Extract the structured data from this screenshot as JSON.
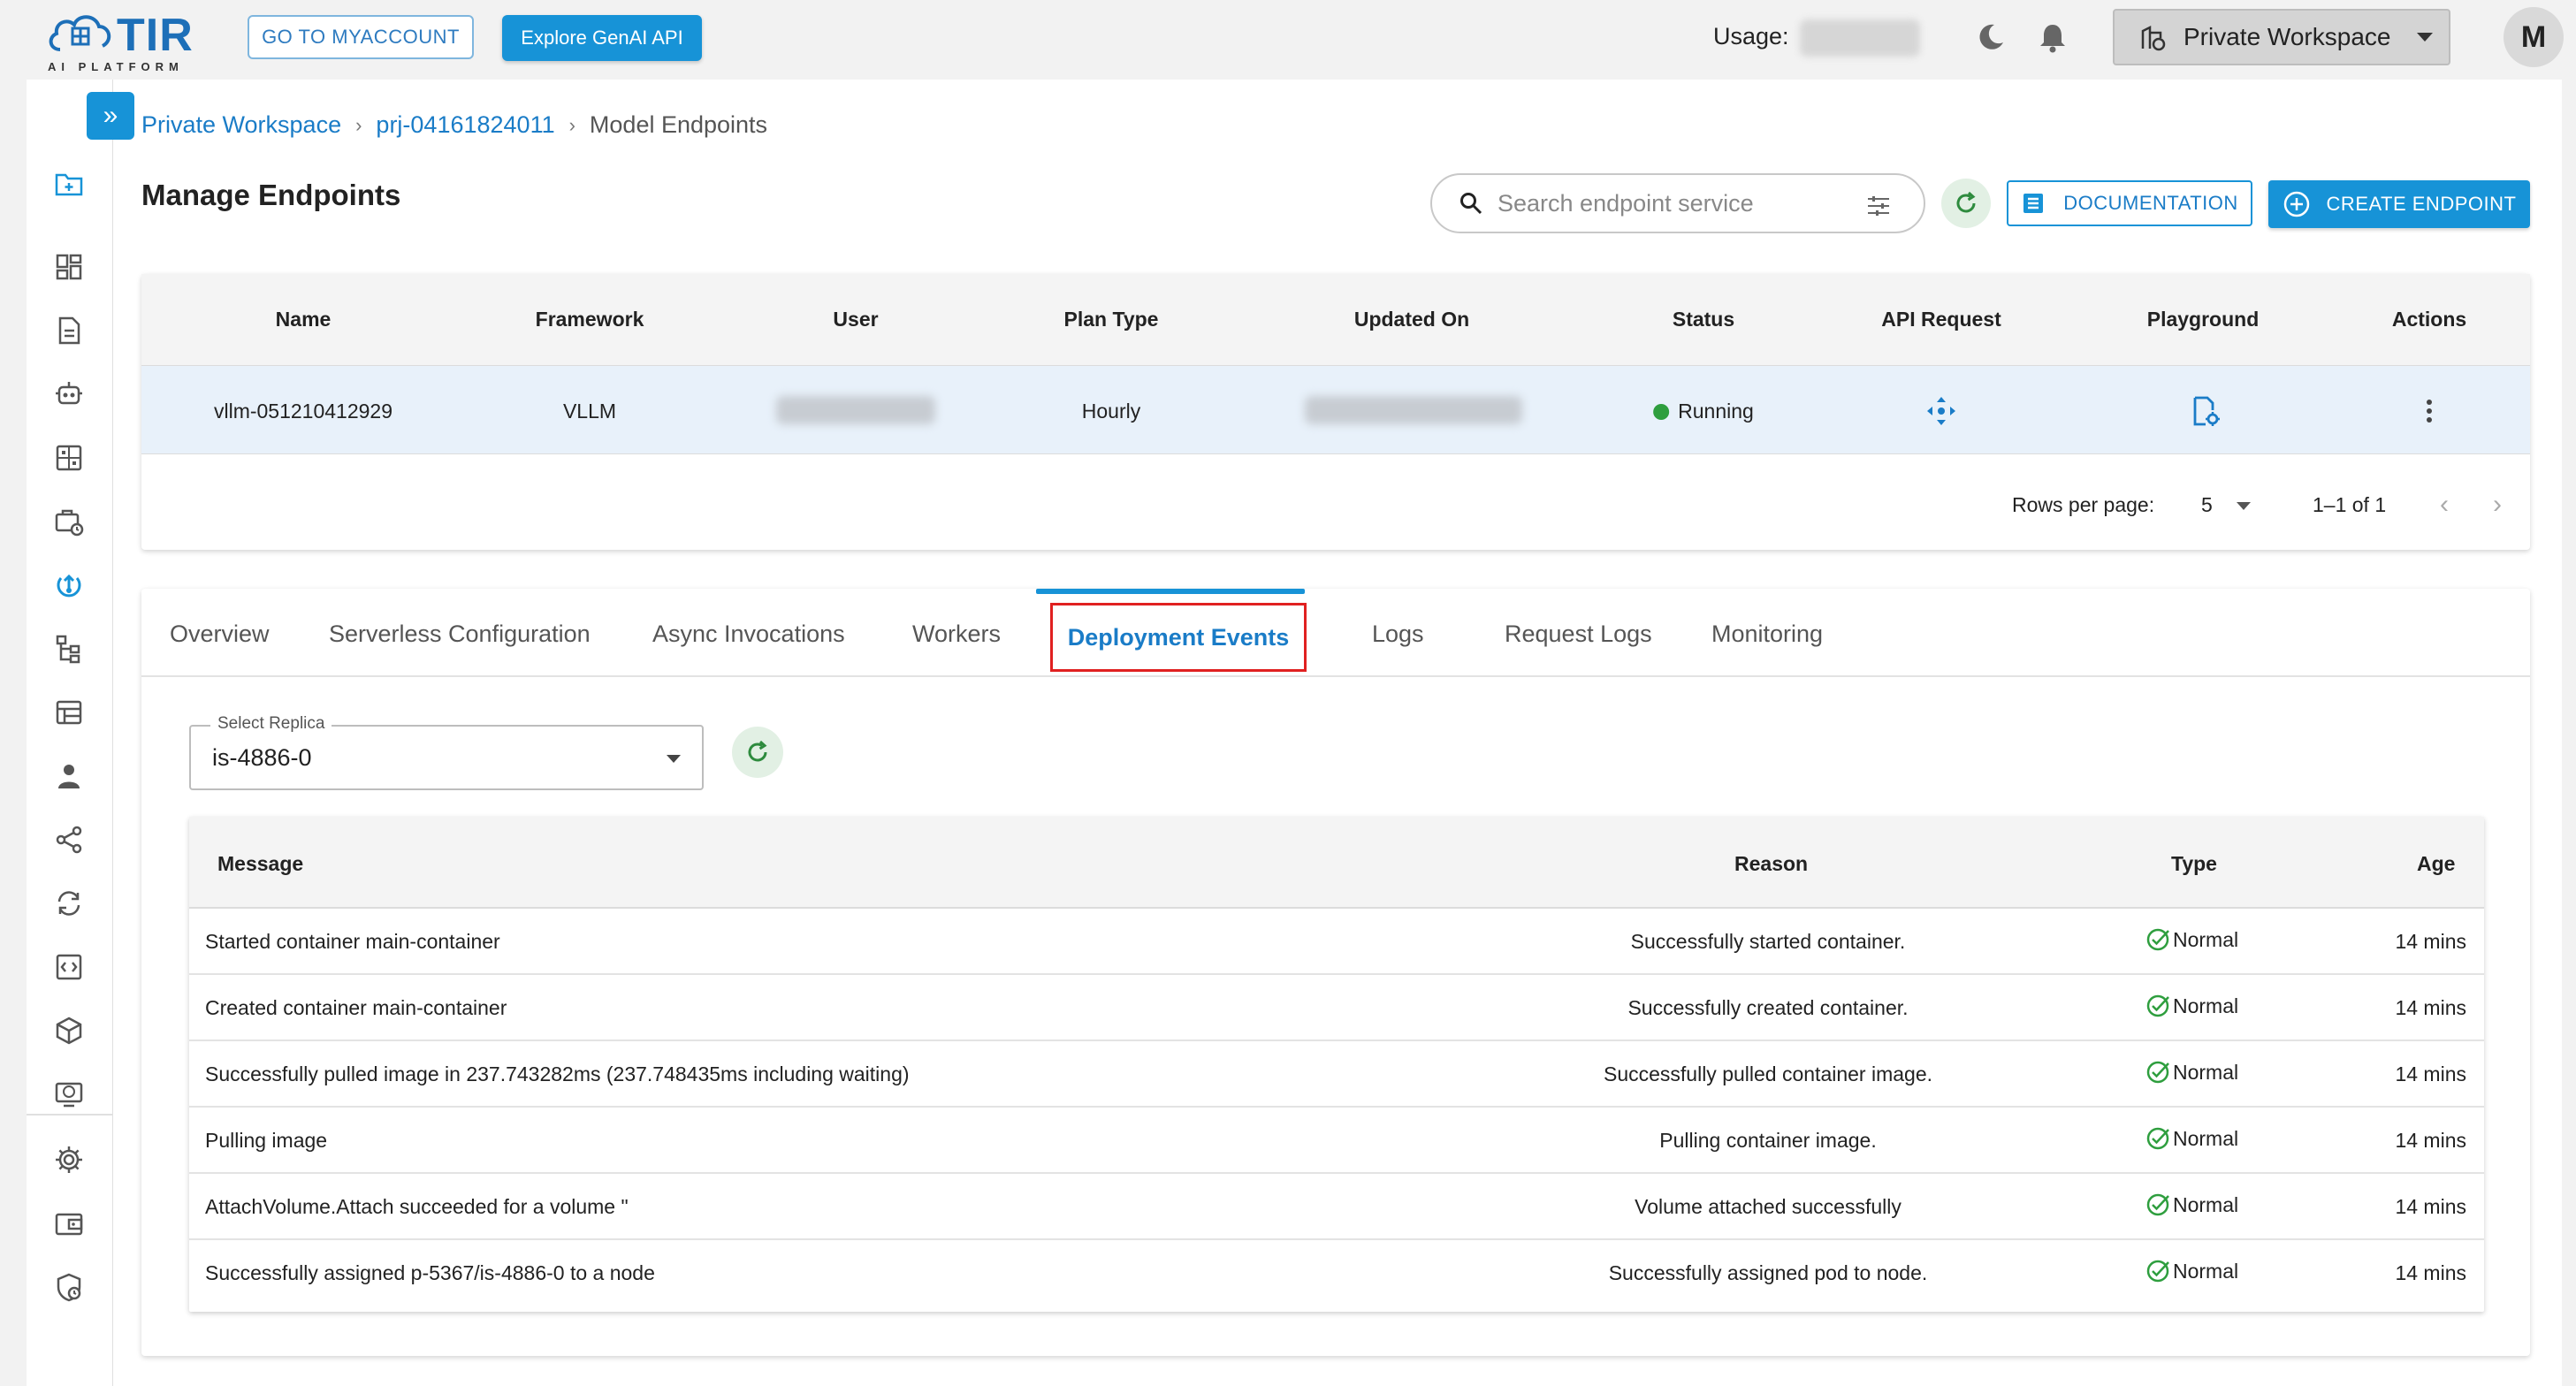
{
  "topbar": {
    "logo_text": "TIR",
    "logo_sub": "AI PLATFORM",
    "myaccount_label": "GO TO MYACCOUNT",
    "genai_label": "Explore GenAI API",
    "usage_label": "Usage:",
    "workspace_label": "Private Workspace",
    "avatar_initial": "M"
  },
  "breadcrumb": {
    "items": [
      "Private Workspace",
      "prj-04161824011",
      "Model Endpoints"
    ],
    "separator": "›"
  },
  "page": {
    "title": "Manage Endpoints",
    "search_placeholder": "Search endpoint service",
    "documentation_label": "DOCUMENTATION",
    "create_label": "CREATE ENDPOINT"
  },
  "endpoints": {
    "columns": [
      "Name",
      "Framework",
      "User",
      "Plan Type",
      "Updated On",
      "Status",
      "API Request",
      "Playground",
      "Actions"
    ],
    "rows": [
      {
        "name": "vllm-051210412929",
        "framework": "VLLM",
        "plan_type": "Hourly",
        "status": "Running"
      }
    ],
    "rows_per_page_label": "Rows per page:",
    "rows_per_page": "5",
    "range": "1–1 of 1"
  },
  "tabs": [
    "Overview",
    "Serverless Configuration",
    "Async Invocations",
    "Workers",
    "Deployment Events",
    "Logs",
    "Request Logs",
    "Monitoring"
  ],
  "active_tab": "Deployment Events",
  "replica": {
    "label": "Select Replica",
    "value": "is-4886-0"
  },
  "events": {
    "columns": [
      "Message",
      "Reason",
      "Type",
      "Age"
    ],
    "rows": [
      {
        "message": "Started container main-container",
        "reason": "Successfully started container.",
        "type": "Normal",
        "age": "14 mins"
      },
      {
        "message": "Created container main-container",
        "reason": "Successfully created container.",
        "type": "Normal",
        "age": "14 mins"
      },
      {
        "message": "Successfully pulled image in 237.743282ms (237.748435ms including waiting)",
        "reason": "Successfully pulled container image.",
        "type": "Normal",
        "age": "14 mins"
      },
      {
        "message": "Pulling image",
        "reason": "Pulling container image.",
        "type": "Normal",
        "age": "14 mins"
      },
      {
        "message": "AttachVolume.Attach succeeded for a volume \"",
        "reason": "Volume attached successfully",
        "type": "Normal",
        "age": "14 mins"
      },
      {
        "message": "Successfully assigned p-5367/is-4886-0 to a node",
        "reason": "Successfully assigned pod to node.",
        "type": "Normal",
        "age": "14 mins"
      }
    ]
  },
  "colors": {
    "accent": "#1793d7",
    "link": "#1a7cc7",
    "running": "#2e9e3e",
    "highlight_border": "#e02020"
  }
}
